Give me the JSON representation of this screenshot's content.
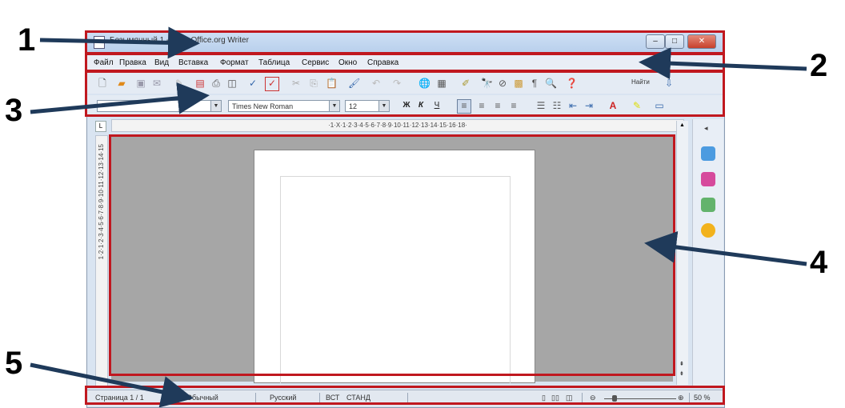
{
  "callouts": [
    "1",
    "2",
    "3",
    "4",
    "5"
  ],
  "window": {
    "title": "Безымянный 1 - OpenOffice.org Writer",
    "buttons": {
      "minimize": "‒",
      "maximize": "□",
      "close": "✕"
    }
  },
  "menubar": {
    "items": [
      "Файл",
      "Правка",
      "Вид",
      "Вставка",
      "Формат",
      "Таблица",
      "Сервис",
      "Окно",
      "Справка"
    ]
  },
  "toolbar": {
    "find_label": "Найти",
    "style_value": "",
    "font_value": "Times New Roman",
    "size_value": "12",
    "bold_label": "Ж",
    "italic_label": "К",
    "underline_label": "Ч"
  },
  "ruler": {
    "horizontal": "·1·X·1·2·3·4·5·6·7·8·9·10·11·12·13·14·15·16·18·",
    "vertical": "1·2·1·2·3·4·5·6·7·8·9·10·11·12·13·14·15"
  },
  "statusbar": {
    "page": "Страница 1 / 1",
    "style": "Обычный",
    "language": "Русский",
    "insert_mode": "ВСТ",
    "selection_mode": "СТАНД",
    "zoom": "50 %"
  },
  "colors": {
    "callout_red": "#c0181f",
    "arrow": "#1f3a5a",
    "doc_background": "#a6a6a6"
  },
  "icons": [
    "new-icon",
    "open-icon",
    "save-icon",
    "pdf-icon",
    "print-icon",
    "spellcheck-icon",
    "cut-icon",
    "copy-icon",
    "paste-icon",
    "undo-icon",
    "redo-icon",
    "hyperlink-icon",
    "table-icon",
    "draw-icon",
    "find-icon",
    "navigator-icon",
    "gallery-icon",
    "help-icon"
  ]
}
